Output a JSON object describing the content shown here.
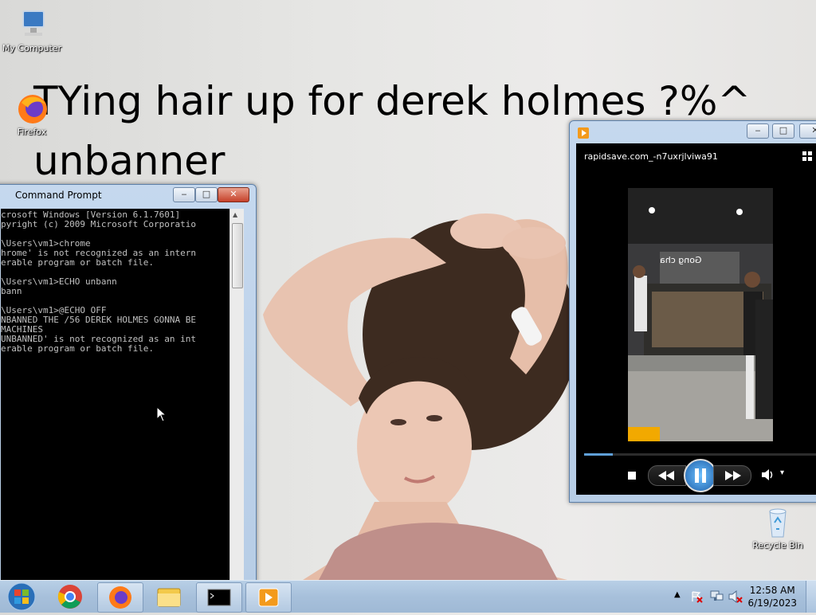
{
  "wallpaper": {
    "line1": "TYing hair up for derek holmes ?%^",
    "line2": "unbanner"
  },
  "desktop_icons": [
    {
      "label": "My Computer",
      "icon": "my-computer-icon"
    },
    {
      "label": "Firefox",
      "icon": "firefox-icon"
    },
    {
      "label": "Recycle Bin",
      "icon": "recycle-bin-icon"
    }
  ],
  "cmd": {
    "title": "Command Prompt",
    "lines": [
      "crosoft Windows [Version 6.1.7601]",
      "pyright (c) 2009 Microsoft Corporatio",
      "",
      "\\Users\\vm1>chrome",
      "hrome' is not recognized as an intern",
      "erable program or batch file.",
      "",
      "\\Users\\vm1>ECHO unbann",
      "bann",
      "",
      "\\Users\\vm1>@ECHO OFF",
      "NBANNED THE /56 DEREK HOLMES GONNA BE",
      "MACHINES",
      "UNBANNED' is not recognized as an int",
      "erable program or batch file."
    ]
  },
  "player": {
    "title": "rapidsave.com_-n7uxrjlviwa91",
    "progress": 0.12,
    "video_sign": "Gong cha"
  },
  "taskbar": {
    "time": "12:58 AM",
    "date": "6/19/2023",
    "items": [
      "start-orb",
      "chrome",
      "firefox",
      "explorer",
      "cmd",
      "media-player"
    ]
  },
  "colors": {
    "taskbar": "#a7c0db",
    "title_bar": "#c5d8ee",
    "console_bg": "#000000",
    "console_text": "#c0c0c0"
  }
}
